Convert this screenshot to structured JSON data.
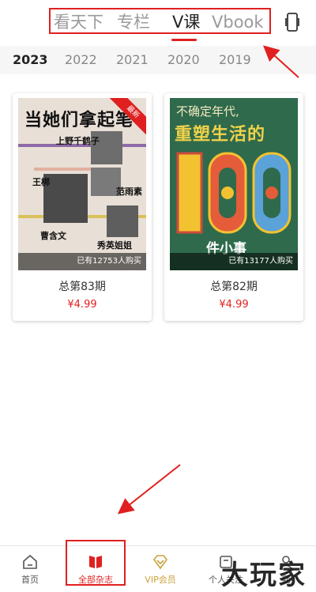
{
  "header": {
    "tabs": [
      {
        "label": "看天下",
        "active": false
      },
      {
        "label": "专栏",
        "active": false
      },
      {
        "label": "V课",
        "active": true
      },
      {
        "label": "Vbook",
        "active": false
      }
    ],
    "device_icon": "phone-outline-icon"
  },
  "years": [
    {
      "label": "2023",
      "active": true
    },
    {
      "label": "2022",
      "active": false
    },
    {
      "label": "2021",
      "active": false
    },
    {
      "label": "2020",
      "active": false
    },
    {
      "label": "2019",
      "active": false
    }
  ],
  "cards": [
    {
      "title": "总第83期",
      "price": "¥4.99",
      "buyers": "已有12753人购买",
      "cover": {
        "headline": "当她们拿起笔",
        "ribbon": "最新",
        "names": [
          "上野千鹤子",
          "王梆",
          "范雨素",
          "曹含文",
          "秀英姐姐"
        ]
      }
    },
    {
      "title": "总第82期",
      "price": "¥4.99",
      "buyers": "已有13177人购买",
      "cover": {
        "top_line": "不确定年代,",
        "main_line": "重塑生活的",
        "number": "100",
        "bottom_line": "件小事"
      }
    }
  ],
  "bottom_nav": [
    {
      "label": "首页",
      "icon": "home-icon",
      "active": false
    },
    {
      "label": "全部杂志",
      "icon": "book-icon",
      "active": true
    },
    {
      "label": "VIP会员",
      "icon": "vip-diamond-icon",
      "active": false
    },
    {
      "label": "个人关注",
      "icon": "follow-icon",
      "active": false
    },
    {
      "label": "我",
      "icon": "user-icon",
      "active": false
    }
  ],
  "watermark": "大玩家",
  "colors": {
    "accent": "#e02020",
    "tab_inactive": "#9a9a9a",
    "year_bg": "#f6f6f6"
  }
}
